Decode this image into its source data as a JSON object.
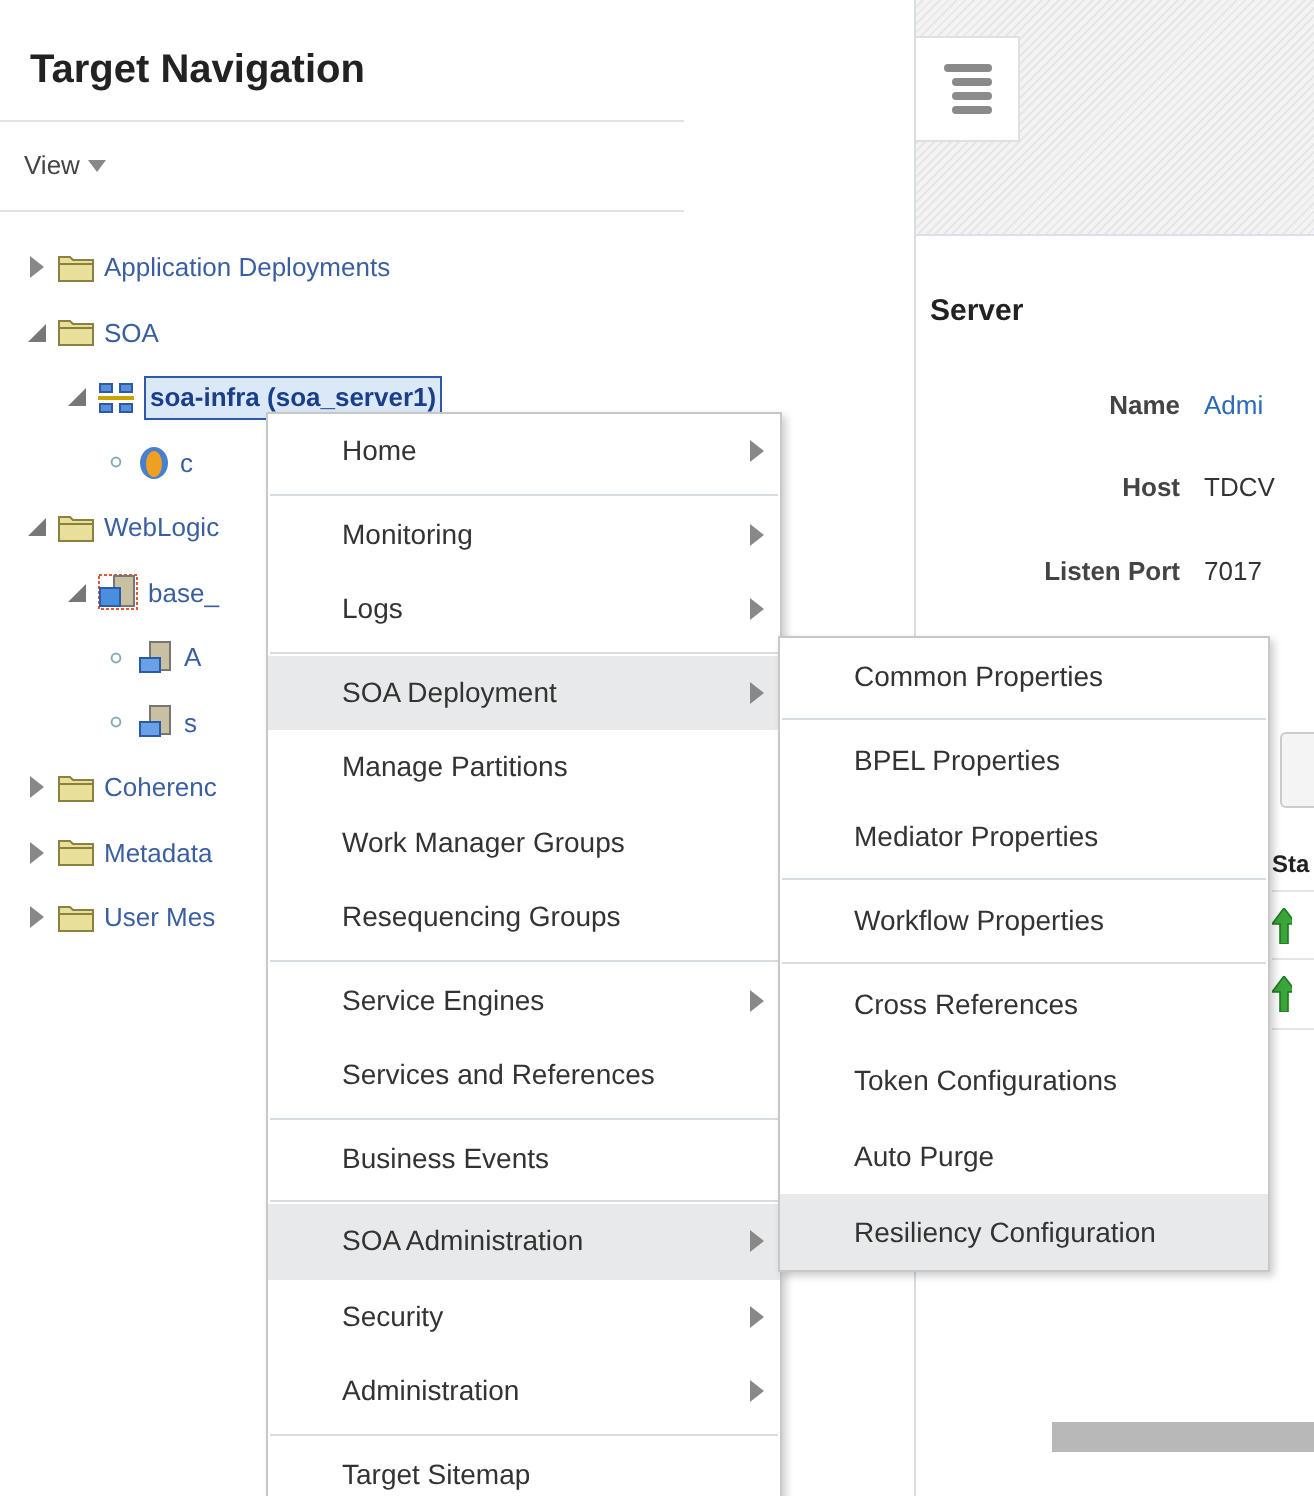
{
  "navigation": {
    "title": "Target Navigation",
    "view_menu": "View",
    "tree": [
      {
        "label": "Application Deployments",
        "kind": "folder",
        "expanded": false,
        "selected": false
      },
      {
        "label": "SOA",
        "kind": "folder",
        "expanded": true,
        "selected": false,
        "children": [
          {
            "label": "soa-infra (soa_server1)",
            "kind": "soa-infra",
            "expanded": true,
            "selected": true,
            "children": [
              {
                "label": "c",
                "kind": "composite",
                "selected": false
              }
            ]
          }
        ]
      },
      {
        "label": "WebLogic",
        "kind": "folder",
        "expanded": true,
        "selected": false,
        "children": [
          {
            "label": "base_",
            "kind": "domain",
            "expanded": true,
            "selected": false,
            "children": [
              {
                "label": "A",
                "kind": "server",
                "selected": false
              },
              {
                "label": "s",
                "kind": "server",
                "selected": false
              }
            ]
          }
        ]
      },
      {
        "label": "Coherenc",
        "kind": "folder",
        "expanded": false,
        "selected": false
      },
      {
        "label": "Metadata",
        "kind": "folder",
        "expanded": false,
        "selected": false
      },
      {
        "label": "User Mes",
        "kind": "folder",
        "expanded": false,
        "selected": false
      }
    ]
  },
  "server": {
    "title": "Server",
    "fields": [
      {
        "label": "Name",
        "value": "Admi",
        "link": true
      },
      {
        "label": "Host",
        "value": "TDCV",
        "link": false
      },
      {
        "label": "Listen Port",
        "value": "7017",
        "link": false
      }
    ],
    "table": {
      "column_1": "Sta"
    }
  },
  "context_menu": {
    "items": [
      {
        "label": "Home",
        "submenu": true,
        "selected": false,
        "divider_after": true
      },
      {
        "label": "Monitoring",
        "submenu": true,
        "selected": false,
        "divider_after": false
      },
      {
        "label": "Logs",
        "submenu": true,
        "selected": false,
        "divider_after": true
      },
      {
        "label": "SOA Deployment",
        "submenu": true,
        "selected": true,
        "divider_after": false
      },
      {
        "label": "Manage Partitions",
        "submenu": false,
        "selected": false,
        "divider_after": false
      },
      {
        "label": "Work Manager Groups",
        "submenu": false,
        "selected": false,
        "divider_after": false
      },
      {
        "label": "Resequencing Groups",
        "submenu": false,
        "selected": false,
        "divider_after": true
      },
      {
        "label": "Service Engines",
        "submenu": true,
        "selected": false,
        "divider_after": false
      },
      {
        "label": "Services and References",
        "submenu": false,
        "selected": false,
        "divider_after": true
      },
      {
        "label": "Business Events",
        "submenu": false,
        "selected": false,
        "divider_after": true
      },
      {
        "label": "SOA Administration",
        "submenu": true,
        "selected": true,
        "divider_after": false
      },
      {
        "label": "Security",
        "submenu": true,
        "selected": false,
        "divider_after": false
      },
      {
        "label": "Administration",
        "submenu": true,
        "selected": false,
        "divider_after": true
      },
      {
        "label": "Target Sitemap",
        "submenu": false,
        "selected": false,
        "divider_after": false
      }
    ]
  },
  "submenu": {
    "items": [
      {
        "label": "Common Properties",
        "selected": false,
        "divider_after": true
      },
      {
        "label": "BPEL Properties",
        "selected": false,
        "divider_after": false
      },
      {
        "label": "Mediator Properties",
        "selected": false,
        "divider_after": true
      },
      {
        "label": "Workflow Properties",
        "selected": false,
        "divider_after": true
      },
      {
        "label": "Cross References",
        "selected": false,
        "divider_after": false
      },
      {
        "label": "Token Configurations",
        "selected": false,
        "divider_after": false
      },
      {
        "label": "Auto Purge",
        "selected": false,
        "divider_after": false
      },
      {
        "label": "Resiliency Configuration",
        "selected": true,
        "divider_after": false
      }
    ]
  }
}
